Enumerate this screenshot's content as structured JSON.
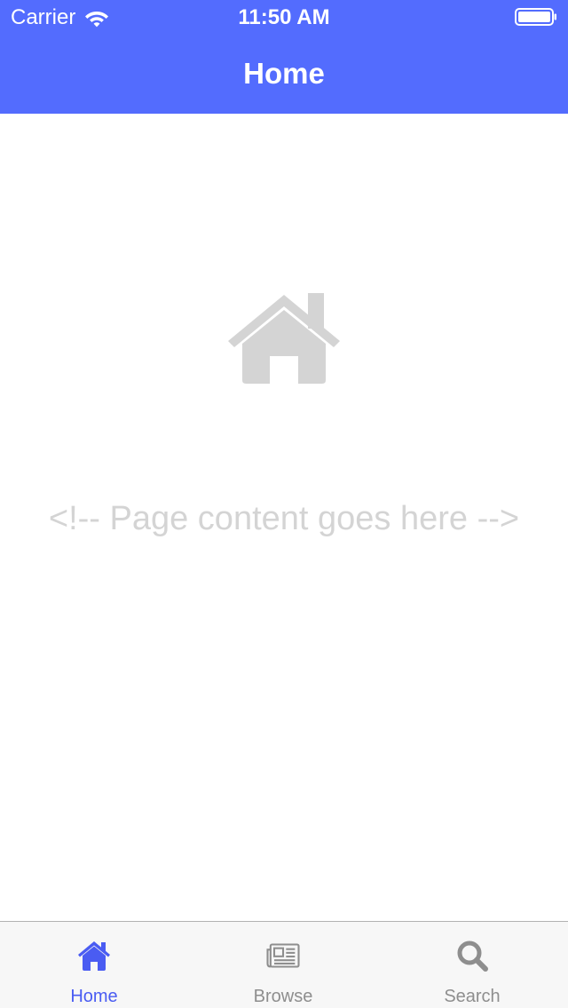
{
  "status_bar": {
    "carrier": "Carrier",
    "time": "11:50 AM",
    "icons": [
      "wifi-icon",
      "battery-icon"
    ]
  },
  "nav": {
    "title": "Home"
  },
  "content": {
    "icon": "home-icon",
    "placeholder": "<!-- Page content goes here -->"
  },
  "tabs": [
    {
      "label": "Home",
      "icon": "home-icon",
      "active": true
    },
    {
      "label": "Browse",
      "icon": "newspaper-icon",
      "active": false
    },
    {
      "label": "Search",
      "icon": "search-icon",
      "active": false
    }
  ],
  "colors": {
    "accent": "#536cfe",
    "tab_active": "#4a5cf2",
    "tab_inactive": "#8e8e8e",
    "placeholder": "#d4d4d4"
  }
}
